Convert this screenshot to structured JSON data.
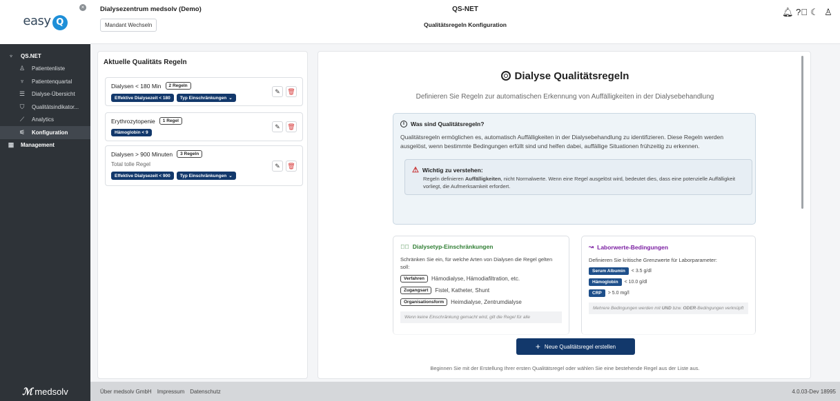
{
  "sidebar": {
    "logo": "easy",
    "logo_q": "Q",
    "items": [
      {
        "label": "QS.NET",
        "icon": "qs-net-icon"
      },
      {
        "label": "Patientenliste",
        "icon": "patient-icon"
      },
      {
        "label": "Patientenquartal",
        "icon": "patient-quarter-icon"
      },
      {
        "label": "Dialyse-Übersicht",
        "icon": "list-icon"
      },
      {
        "label": "Qualitätsindikator...",
        "icon": "shield-check-icon"
      },
      {
        "label": "Analytics",
        "icon": "chart-icon"
      },
      {
        "label": "Konfiguration",
        "icon": "sliders-icon"
      },
      {
        "label": "Management",
        "icon": "building-icon"
      }
    ]
  },
  "header": {
    "tenant": "Dialysezentrum medsolv (Demo)",
    "switch_label": "Mandant Wechseln",
    "app_title": "QS-NET",
    "page_subtitle": "Qualitätsregeln Konfiguration"
  },
  "rules": {
    "title": "Aktuelle Qualitäts Regeln",
    "items": [
      {
        "name": "Dialysen < 180 Min",
        "count": "2 Regeln",
        "desc": "",
        "chips": [
          "Effektive Dialysezeit < 180",
          "Typ Einschränkungen"
        ]
      },
      {
        "name": "Erythrozytopenie",
        "count": "1 Regel",
        "desc": "",
        "chips": [
          "Hämoglobin < 9"
        ]
      },
      {
        "name": "Dialysen > 900 Minuten",
        "count": "3 Regeln",
        "desc": "Total tolle Regel",
        "chips": [
          "Effektive Dialysezeit < 900",
          "Typ Einschränkungen"
        ]
      }
    ]
  },
  "main": {
    "title": "Dialyse Qualitätsregeln",
    "subtitle": "Definieren Sie Regeln zur automatischen Erkennung von Auffälligkeiten in der Dialysebehandlung",
    "info": {
      "head": "Was sind Qualitätsregeln?",
      "text": "Qualitätsregeln ermöglichen es, automatisch Auffälligkeiten in der Dialysebehandlung zu identifizieren. Diese Regeln werden ausgelöst, wenn bestimmte Bedingungen erfüllt sind und helfen dabei, auffällige Situationen frühzeitig zu erkennen.",
      "warn_head": "Wichtig zu verstehen:",
      "warn_pre": "Regeln definieren ",
      "warn_bold": "Auffälligkeiten",
      "warn_post": ", nicht Normalwerte. Wenn eine Regel ausgelöst wird, bedeutet dies, dass eine potenzielle Auffälligkeit vorliegt, die Aufmerksamkeit erfordert."
    },
    "type_card": {
      "head": "Dialysetyp-Einschränkungen",
      "desc": "Schränken Sie ein, für welche Arten von Dialysen die Regel gelten soll:",
      "rows": [
        {
          "badge": "Verfahren",
          "text": "Hämodialyse, Hämodiafiltration, etc."
        },
        {
          "badge": "Zugangsart",
          "text": "Fistel, Katheter, Shunt"
        },
        {
          "badge": "Organisationsform",
          "text": "Heimdialyse, Zentrumdialyse"
        }
      ],
      "note": "Wenn keine Einschränkung gemacht wird, gilt die Regel für alle"
    },
    "lab_card": {
      "head": "Laborwerte-Bedingungen",
      "desc": "Definieren Sie kritische Grenzwerte für Laborparameter:",
      "rows": [
        {
          "badge": "Serum Albumin",
          "text": "< 3.5 g/dl"
        },
        {
          "badge": "Hämoglobin",
          "text": "< 10.0 g/dl"
        },
        {
          "badge": "CRP",
          "text": "> 5.0 mg/l"
        }
      ],
      "note_pre": "Mehrere Bedingungen werden mit ",
      "note_und": "UND",
      "note_mid": " bzw. ",
      "note_oder": "ODER",
      "note_post": "-Bedingungen verknüpft"
    },
    "cta_label": "Neue Qualitätsregel erstellen",
    "hint": "Beginnen Sie mit der Erstellung Ihrer ersten Qualitätsregel oder wählen Sie eine bestehende Regel aus der Liste aus."
  },
  "footer": {
    "brand": "medsolv",
    "links": [
      "Über medsolv GmbH",
      "Impressum",
      "Datenschutz"
    ],
    "version": "4.0.03-Dev 18995"
  },
  "colors": {
    "sidebar_bg": "#2e3338",
    "primary": "#12386b",
    "danger": "#d63a3a",
    "success": "#2e7d32",
    "purple": "#7b1fa2"
  }
}
